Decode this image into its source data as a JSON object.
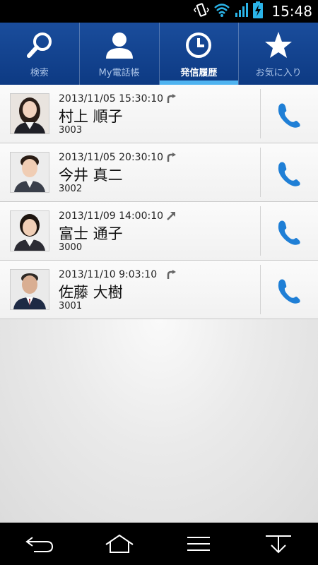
{
  "status_bar": {
    "time": "15:48",
    "icons": [
      "vibrate-icon",
      "wifi-icon",
      "signal-icon",
      "battery-charging-icon"
    ]
  },
  "tabs": [
    {
      "label": "検索",
      "icon": "search-icon",
      "active": false
    },
    {
      "label": "My電話帳",
      "icon": "person-icon",
      "active": false
    },
    {
      "label": "発信履歴",
      "icon": "clock-icon",
      "active": true
    },
    {
      "label": "お気に入り",
      "icon": "star-icon",
      "active": false
    }
  ],
  "history": [
    {
      "datetime": "2013/11/05 15:30:10",
      "direction_icon": "redial-icon",
      "name": "村上 順子",
      "ext": "3003"
    },
    {
      "datetime": "2013/11/05 20:30:10",
      "direction_icon": "redial-icon",
      "name": "今井 真二",
      "ext": "3002"
    },
    {
      "datetime": "2013/11/09 14:00:10",
      "direction_icon": "outgoing-arrow-icon",
      "name": "富士 通子",
      "ext": "3000"
    },
    {
      "datetime": "2013/11/10 9:03:10",
      "direction_icon": "redial-icon",
      "name": "佐藤 大樹",
      "ext": "3001"
    }
  ],
  "nav": [
    "back-icon",
    "home-icon",
    "menu-icon",
    "collapse-icon"
  ],
  "colors": {
    "header": "#0d3a83",
    "active_tab_indicator": "#4fb3f0",
    "call_icon": "#1f7fd6"
  }
}
